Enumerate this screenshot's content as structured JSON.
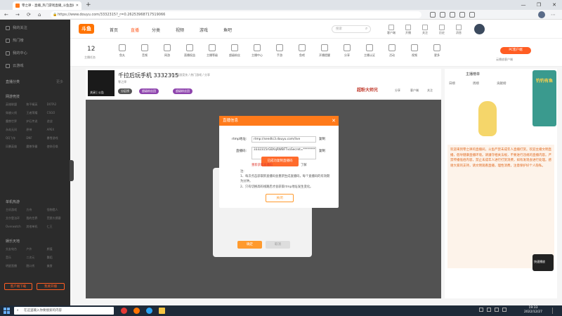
{
  "browser": {
    "tab_title": "零之律 - 直播_热门游戏直播_斗鱼直播",
    "url": "https://www.douyu.com/3332315?_r=0.26253968717519066",
    "new_tab": "+",
    "controls": [
      "—",
      "❐",
      "✕"
    ]
  },
  "sidebar": {
    "items": [
      {
        "label": "我的关注"
      },
      {
        "label": "热门榜"
      },
      {
        "label": "我的中心"
      },
      {
        "label": "云游戏"
      }
    ],
    "sections": [
      "直播分类",
      "网游竞技",
      "单机热游",
      "娱乐天地",
      "手游休闲",
      "科技文化"
    ],
    "more": "更多",
    "grid1": [
      "英雄联盟",
      "和平精英",
      "DOTA2",
      "穿越火线",
      "王者荣耀",
      "CSGO",
      "魔兽世界",
      "炉石传说",
      "逆战",
      "永劫无间",
      "原神",
      "APEX",
      "QQ飞车",
      "DNF",
      "暴雪游戏",
      "风暴英雄",
      "魔兽争霸",
      "使命召唤"
    ],
    "grid2": [
      "主机游戏",
      "方舟",
      "怪物猎人",
      "艾尔登法环",
      "我的世界",
      "荒野大镖客",
      "Overwatch",
      "其他单机",
      "仁王"
    ],
    "grid3": [
      "交友电台",
      "户外",
      "颜值",
      "音乐",
      "二次元",
      "舞蹈",
      "明星直播",
      "脱口秀",
      "美食"
    ],
    "btn_left": "客户端下载",
    "btn_right": "我要开播"
  },
  "header": {
    "logo": "斗鱼",
    "nav": [
      "首页",
      "直播",
      "分类",
      "视频",
      "游戏",
      "鱼吧"
    ],
    "search_placeholder": "搜索",
    "icons": [
      {
        "label": "客户端",
        "icon": "download-icon"
      },
      {
        "label": "开播",
        "icon": "camera-icon"
      },
      {
        "label": "关注",
        "icon": "heart-icon"
      },
      {
        "label": "历史",
        "icon": "clock-icon"
      },
      {
        "label": "消息",
        "icon": "bell-icon"
      }
    ]
  },
  "catbar": {
    "count": "12",
    "count_label": "主播任务",
    "items": [
      "鱼丸",
      "音频",
      "网游",
      "直播权益",
      "主播等级",
      "超级粉丝",
      "主播中心",
      "手游",
      "鱼吧",
      "开播提醒",
      "分享",
      "主播认证",
      "活动",
      "视频",
      "更多"
    ],
    "pc_button": "PC客户端",
    "pc_sub": "云播放客户端"
  },
  "room": {
    "thumb_label": "关闭 | 公告",
    "title": "千拉后玩手机 3332315",
    "subtitle": "举报  网游竞技 / 热门游戏 / 分享",
    "streamer": "零之律",
    "tags": [
      "分区榜",
      "超级粉丝团",
      "超级粉丝团"
    ],
    "brand": "超粉大师兄",
    "actions": [
      "分享",
      "客户端",
      "关注"
    ]
  },
  "modal": {
    "title": "直播信息",
    "rtmp_label": "rtmp地址:",
    "rtmp_value": "rtmp://sendtc3.douyu.com/live",
    "code_label": "直播码:",
    "code_value": "3332315rGBXqRWBFTvoSecret=************",
    "copy": "复制",
    "toast": "已成功复制直播码",
    "refresh_hint": "重新获取直播码",
    "learn_more": "了解",
    "notes_title": "注:",
    "notes": [
      "1、每次点击获取新直播码会重新生成直播码，每个直播码的有效期为分钟。",
      "2、只有切换高码线路后才会获取rtmp地址发生变化。"
    ],
    "ok": "关闭"
  },
  "dim_panel": {
    "btn_primary": "确定",
    "btn_secondary": "取消"
  },
  "right_panel": {
    "header": "主播榜单",
    "tabs": [
      "日榜",
      "周榜",
      "贡献榜"
    ],
    "notice": "欢迎来到零之律的直播间，斗鱼严禁未成年人直播打赏。欢迎主播文明直播，倡导健康直播环境。请遵守相关法规，不要进行违规的直播内容。严禁传播低俗内容，禁止未成年人进行打赏消费，如有发现会进行处理。感谢大家的支持，请文明观看直播，理性消费，注意保护好个人隐私。"
  },
  "banner": {
    "text": "钓钓有鱼"
  },
  "corner_badge": "快速播放",
  "taskbar": {
    "search_placeholder": "在这里输入你要搜索的内容",
    "time": "19:33",
    "date": "2022/12/27"
  }
}
